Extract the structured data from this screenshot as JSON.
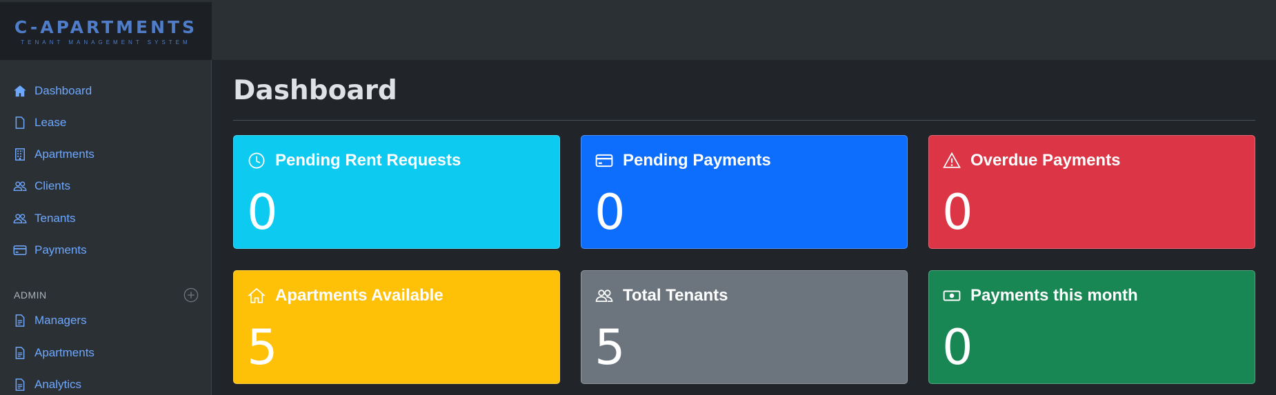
{
  "brand": {
    "title": "C-APARTMENTS",
    "subtitle": "TENANT MANAGEMENT SYSTEM"
  },
  "sidebar": {
    "items": [
      {
        "label": "Dashboard",
        "icon": "house-icon"
      },
      {
        "label": "Lease",
        "icon": "file-icon"
      },
      {
        "label": "Apartments",
        "icon": "building-icon"
      },
      {
        "label": "Clients",
        "icon": "people-icon"
      },
      {
        "label": "Tenants",
        "icon": "people-icon"
      },
      {
        "label": "Payments",
        "icon": "credit-card-icon"
      }
    ],
    "admin_header": "ADMIN",
    "admin_items": [
      {
        "label": "Managers",
        "icon": "file-text-icon"
      },
      {
        "label": "Apartments",
        "icon": "file-text-icon"
      },
      {
        "label": "Analytics",
        "icon": "file-text-icon"
      }
    ]
  },
  "main": {
    "title": "Dashboard",
    "cards": [
      {
        "label": "Pending Rent Requests",
        "value": "0",
        "color": "#0dcaf0",
        "icon": "clock-icon"
      },
      {
        "label": "Pending Payments",
        "value": "0",
        "color": "#0d6efd",
        "icon": "credit-card-icon"
      },
      {
        "label": "Overdue Payments",
        "value": "0",
        "color": "#dc3545",
        "icon": "warning-icon"
      },
      {
        "label": "Apartments Available",
        "value": "5",
        "color": "#ffc107",
        "icon": "house-icon"
      },
      {
        "label": "Total Tenants",
        "value": "5",
        "color": "#6c757d",
        "icon": "people-icon"
      },
      {
        "label": "Payments this month",
        "value": "0",
        "color": "#198754",
        "icon": "cash-icon"
      }
    ]
  }
}
